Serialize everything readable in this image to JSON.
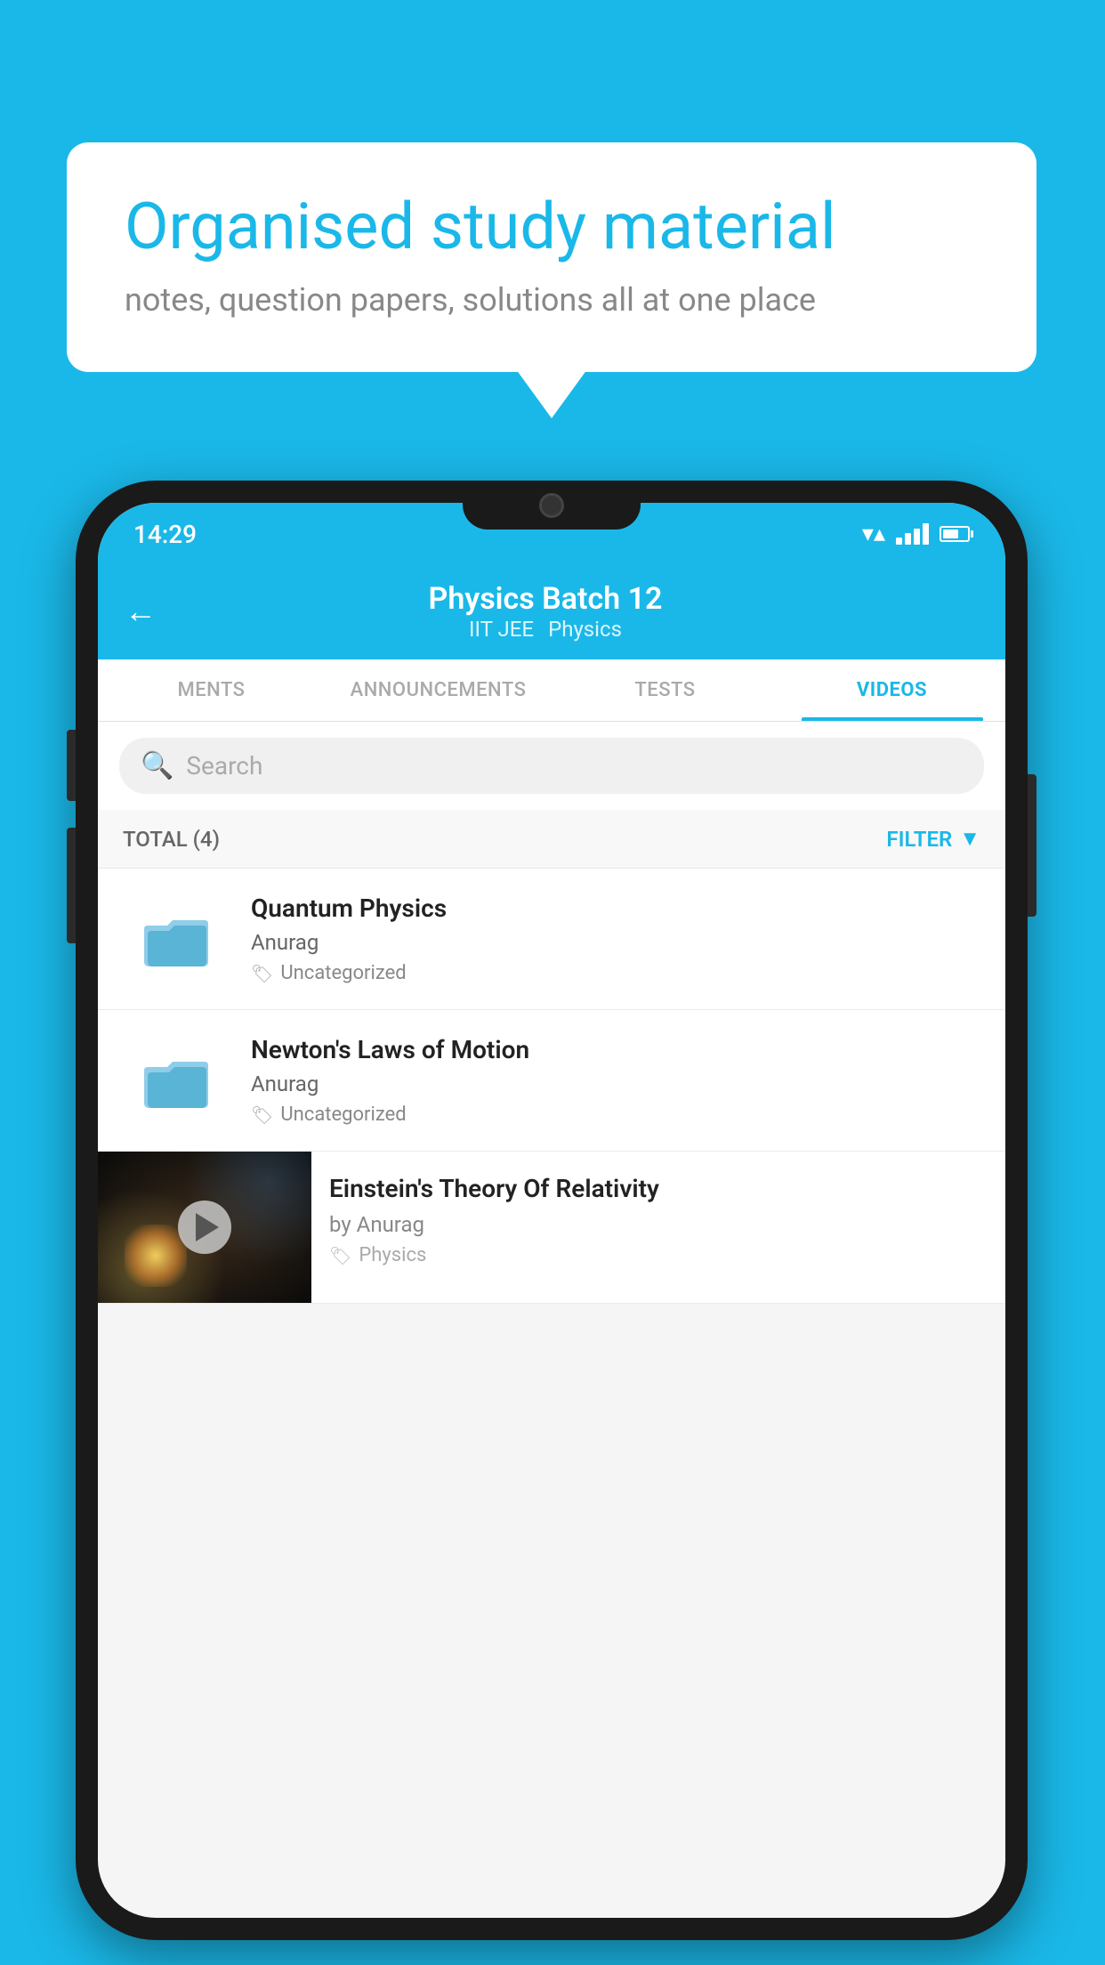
{
  "background_color": "#1ab8e8",
  "speech_bubble": {
    "title": "Organised study material",
    "subtitle": "notes, question papers, solutions all at one place"
  },
  "phone": {
    "status_bar": {
      "time": "14:29"
    },
    "header": {
      "title": "Physics Batch 12",
      "tag1": "IIT JEE",
      "tag2": "Physics",
      "back_label": "←"
    },
    "tabs": [
      {
        "label": "MENTS",
        "active": false
      },
      {
        "label": "ANNOUNCEMENTS",
        "active": false
      },
      {
        "label": "TESTS",
        "active": false
      },
      {
        "label": "VIDEOS",
        "active": true
      }
    ],
    "search": {
      "placeholder": "Search"
    },
    "filter_row": {
      "total_label": "TOTAL (4)",
      "filter_label": "FILTER"
    },
    "videos": [
      {
        "id": 1,
        "title": "Quantum Physics",
        "author": "Anurag",
        "tag": "Uncategorized",
        "has_thumb": false
      },
      {
        "id": 2,
        "title": "Newton's Laws of Motion",
        "author": "Anurag",
        "tag": "Uncategorized",
        "has_thumb": false
      },
      {
        "id": 3,
        "title": "Einstein's Theory Of Relativity",
        "author": "by Anurag",
        "tag": "Physics",
        "has_thumb": true
      }
    ]
  }
}
